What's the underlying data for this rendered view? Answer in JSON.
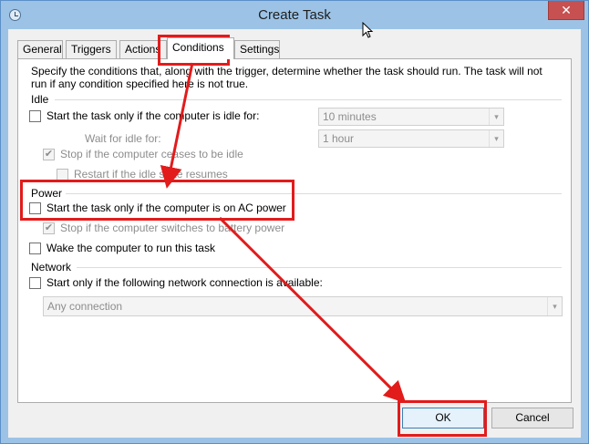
{
  "window": {
    "title": "Create Task",
    "close_label": "✕"
  },
  "tabs": [
    {
      "label": "General"
    },
    {
      "label": "Triggers"
    },
    {
      "label": "Actions"
    },
    {
      "label": "Conditions"
    },
    {
      "label": "Settings"
    }
  ],
  "description": "Specify the conditions that, along with the trigger, determine whether the task should run.  The task will not run  if any condition specified here is not true.",
  "idle": {
    "group_label": "Idle",
    "start_idle_label": "Start the task only if the computer is idle for:",
    "idle_duration": "10 minutes",
    "wait_label": "Wait for idle for:",
    "wait_duration": "1 hour",
    "stop_label": "Stop if the computer ceases to be idle",
    "restart_label": "Restart if the idle state resumes"
  },
  "power": {
    "group_label": "Power",
    "ac_label": "Start the task only if the computer is on AC power",
    "battery_label": "Stop if the computer switches to battery power",
    "wake_label": "Wake the computer to run this task"
  },
  "network": {
    "group_label": "Network",
    "start_label": "Start only if the following network connection is available:",
    "connection": "Any connection"
  },
  "buttons": {
    "ok": "OK",
    "cancel": "Cancel"
  },
  "colors": {
    "highlight": "#e21b1b",
    "title_bar": "#9cc3e6",
    "close_button": "#c75050"
  },
  "icons": {
    "check": "✔",
    "dropdown": "▾"
  }
}
